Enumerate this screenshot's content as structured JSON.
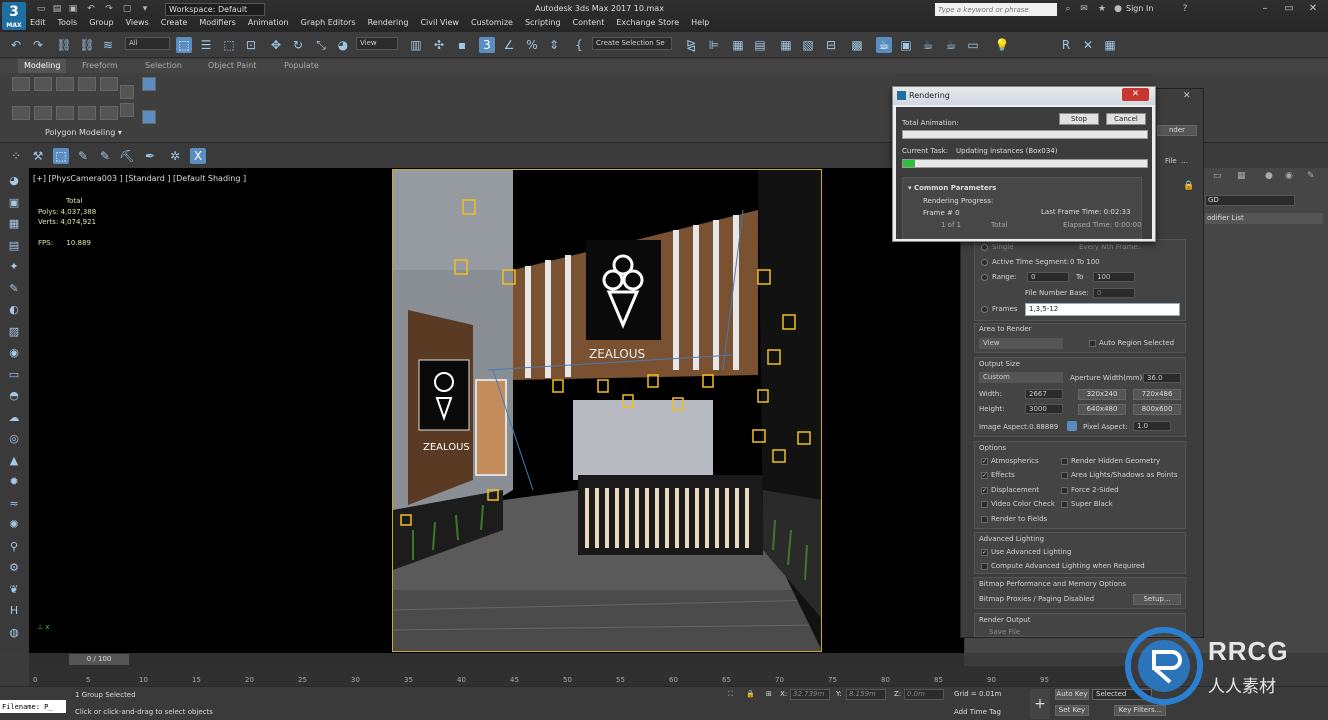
{
  "app": {
    "title": "Autodesk 3ds Max 2017    10.max",
    "logo_text": "3",
    "logo_sub": "MAX",
    "workspace": "Workspace: Default",
    "search_placeholder": "Type a keyword or phrase",
    "sign_in": "Sign In"
  },
  "menu": [
    "Edit",
    "Tools",
    "Group",
    "Views",
    "Create",
    "Modifiers",
    "Animation",
    "Graph Editors",
    "Rendering",
    "Civil View",
    "Customize",
    "Scripting",
    "Content",
    "Exchange Store",
    "Help"
  ],
  "toolbar": {
    "selection_filter": "All",
    "ref_coord": "View",
    "named_selection": "Create Selection Se"
  },
  "ribbon": {
    "tabs": [
      "Modeling",
      "Freeform",
      "Selection",
      "Object Paint",
      "Populate"
    ],
    "active_tab": "Modeling",
    "panel_label": "Polygon Modeling"
  },
  "viewport": {
    "label": "[+] [PhysCamera003 ] [Standard ] [Default Shading ]",
    "stats": {
      "total_label": "Total",
      "polys_label": "Polys:",
      "polys": "4,037,388",
      "verts_label": "Verts:",
      "verts": "4,074,921",
      "fps_label": "FPS:",
      "fps": "10.889"
    },
    "brand": "ZEALOUS"
  },
  "rendering_dialog": {
    "title": "Rendering",
    "total_animation": "Total Animation:",
    "stop": "Stop",
    "cancel": "Cancel",
    "current_task_label": "Current Task:",
    "current_task": "Updating instances (Box034)",
    "task_progress": 0.05,
    "common_parameters": "Common Parameters",
    "rendering_progress": "Rendering Progress:",
    "frame_label": "Frame #",
    "frame_value": "0",
    "last_frame_time_label": "Last Frame Time:",
    "last_frame_time": "0:02:33",
    "of_label": "1 of 1",
    "total_label": "Total",
    "elapsed_time_label": "Elapsed Time:",
    "elapsed_time": "0:00:00"
  },
  "render_setup": {
    "right_btn": "nder",
    "file_label": "File",
    "single": "Single",
    "every_nth": "Every Nth Frame:",
    "active_time_segment": "Active Time Segment:",
    "active_time_range": "0 To 100",
    "range": "Range:",
    "range_from": "0",
    "range_to_label": "To",
    "range_to": "100",
    "file_number_base": "File Number Base:",
    "file_number_base_value": "0",
    "frames": "Frames",
    "frames_value": "1,3,5-12",
    "area_to_render": "Area to Render",
    "area_value": "View",
    "auto_region": "Auto Region Selected",
    "output_size": "Output Size",
    "size_preset": "Custom",
    "aperture_label": "Aperture Width(mm):",
    "aperture_value": "36.0",
    "width_label": "Width:",
    "width": "2667",
    "height_label": "Height:",
    "height": "3000",
    "presets": [
      "320x240",
      "720x486",
      "640x480",
      "800x600"
    ],
    "image_aspect": "Image Aspect:0.88889",
    "pixel_aspect_label": "Pixel Aspect:",
    "pixel_aspect": "1.0",
    "options": "Options",
    "opt_atmospherics": "Atmospherics",
    "opt_render_hidden": "Render Hidden Geometry",
    "opt_effects": "Effects",
    "opt_area_lights": "Area Lights/Shadows as Points",
    "opt_displacement": "Displacement",
    "opt_force2sided": "Force 2-Sided",
    "opt_video_color": "Video Color Check",
    "opt_super_black": "Super Black",
    "opt_render_fields": "Render to Fields",
    "advanced_lighting": "Advanced Lighting",
    "use_adv_lighting": "Use Advanced Lighting",
    "compute_adv_lighting": "Compute Advanced Lighting when Required",
    "bitmap_perf": "Bitmap Performance and Memory Options",
    "bitmap_proxies": "Bitmap Proxies / Paging Disabled",
    "setup_btn": "Setup...",
    "render_output": "Render Output",
    "save_file": "Save File"
  },
  "command_panel": {
    "name_field": "GD",
    "modifier_list": "odifier List"
  },
  "timeline": {
    "slider": "0 / 100",
    "ticks": [
      "0",
      "5",
      "10",
      "15",
      "20",
      "25",
      "30",
      "35",
      "40",
      "45",
      "50",
      "55",
      "60",
      "65",
      "70",
      "75",
      "80",
      "85",
      "90",
      "95"
    ]
  },
  "status": {
    "listener": "Filename: P_",
    "message1": "1 Group Selected",
    "message2": "Click or click-and-drag to select objects",
    "x_label": "X:",
    "x": "32.739m",
    "y_label": "Y:",
    "y": "8.159m",
    "z_label": "Z:",
    "z": "0.0m",
    "grid": "Grid = 0.01m",
    "add_time_tag": "Add Time Tag",
    "auto_key": "Auto Key",
    "set_key": "Set Key",
    "selected": "Selected",
    "key_filters": "Key Filters..."
  },
  "watermark": {
    "text": "RRCG",
    "sub": "人人素材"
  },
  "colors": {
    "accent": "#5a8ec0",
    "progress_green": "#2fbf40",
    "frame_border": "#c8a830",
    "close_red": "#c7372f"
  }
}
